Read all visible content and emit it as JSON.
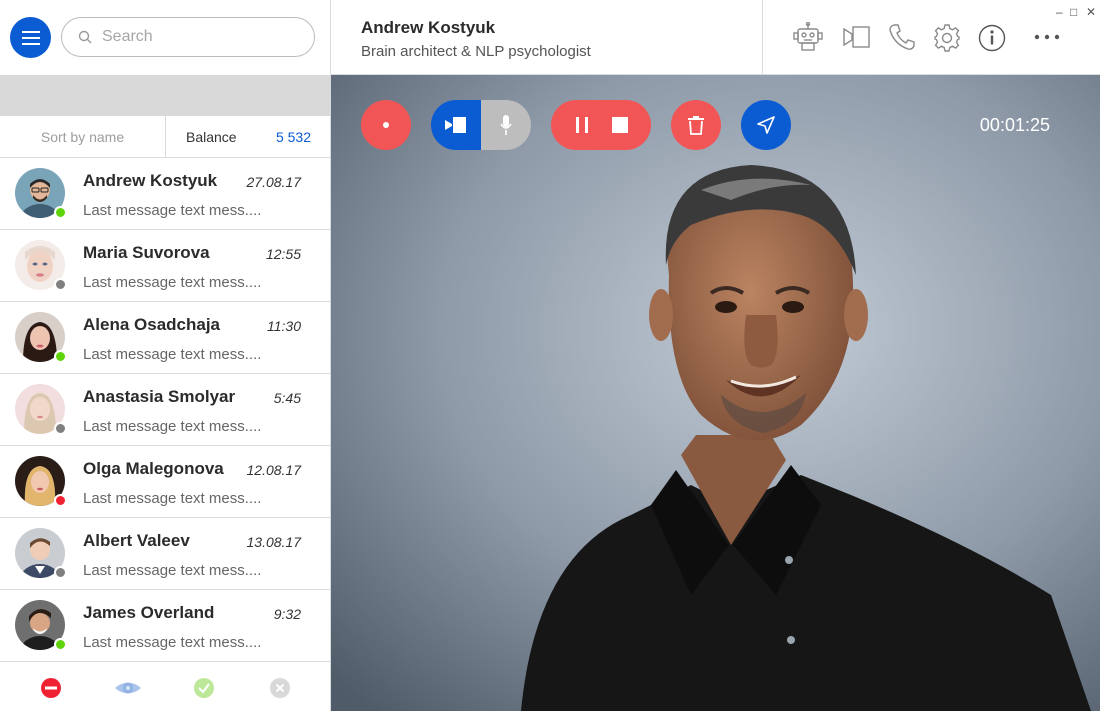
{
  "search": {
    "placeholder": "Search"
  },
  "sort": {
    "label": "Sort by name"
  },
  "balance": {
    "label": "Balance",
    "value": "5 532"
  },
  "contacts": [
    {
      "name": "Andrew Kostyuk",
      "time": "27.08.17",
      "message": "Last message text mess....",
      "status": "online",
      "status_color": "#5fd40a"
    },
    {
      "name": "Maria Suvorova",
      "time": "12:55",
      "message": "Last message text mess....",
      "status": "offline",
      "status_color": "#808080"
    },
    {
      "name": "Alena Osadchaja",
      "time": "11:30",
      "message": "Last message text mess....",
      "status": "online",
      "status_color": "#5fd40a"
    },
    {
      "name": "Anastasia Smolyar",
      "time": "5:45",
      "message": "Last message text mess....",
      "status": "offline",
      "status_color": "#808080"
    },
    {
      "name": "Olga Malegonova",
      "time": "12.08.17",
      "message": "Last message text mess....",
      "status": "busy",
      "status_color": "#ee2233"
    },
    {
      "name": "Albert Valeev",
      "time": "13.08.17",
      "message": "Last message text mess....",
      "status": "offline",
      "status_color": "#808080"
    },
    {
      "name": "James Overland",
      "time": "9:32",
      "message": "Last message text mess....",
      "status": "online",
      "status_color": "#5fd40a"
    }
  ],
  "bottom_bar": {
    "icons": [
      "busy-filter-icon",
      "visible-filter-icon",
      "online-filter-icon",
      "offline-filter-icon"
    ]
  },
  "header": {
    "name": "Andrew Kostyuk",
    "subtitle": "Brain architect & NLP psychologist",
    "icons": [
      "robot-icon",
      "video-call-icon",
      "phone-icon",
      "settings-icon",
      "info-icon",
      "more-icon"
    ]
  },
  "call": {
    "timer": "00:01:25",
    "controls": [
      "record-button",
      "camera-toggle",
      "mic-toggle",
      "pause-button",
      "stop-button",
      "delete-button",
      "send-button"
    ]
  },
  "colors": {
    "accent": "#0b5bd3",
    "danger": "#f25555",
    "online": "#5fd40a",
    "busy": "#ee2233",
    "offline": "#808080"
  }
}
